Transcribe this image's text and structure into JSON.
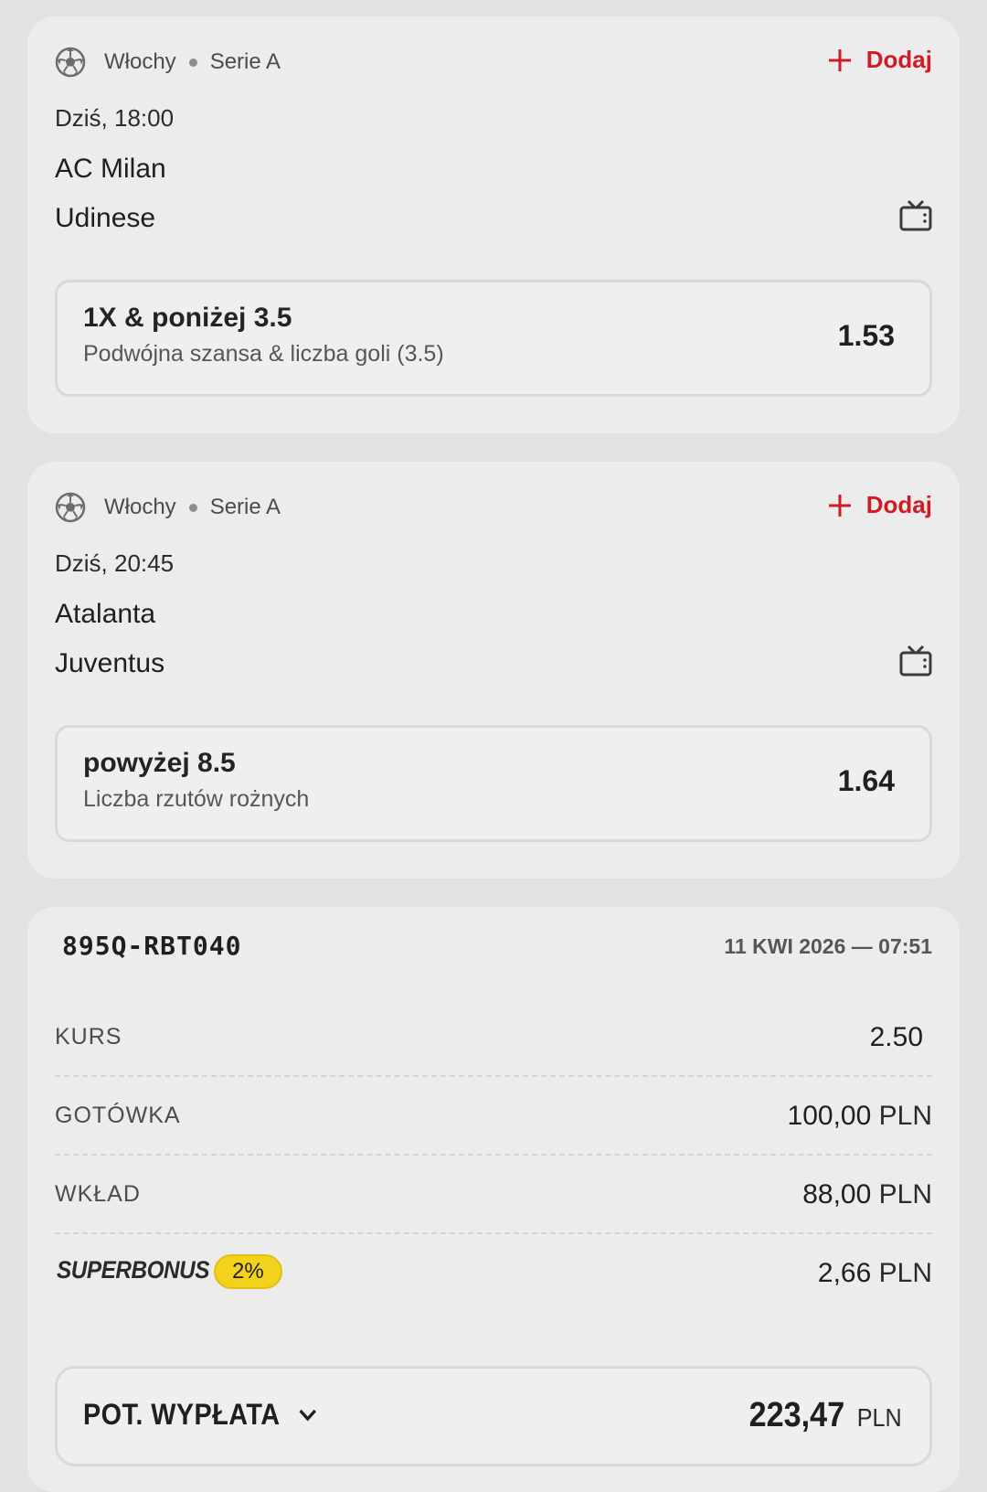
{
  "matches": [
    {
      "country": "Włochy",
      "league": "Serie A",
      "add_label": "Dodaj",
      "time": "Dziś, 18:00",
      "home": "AC Milan",
      "away": "Udinese",
      "bet": {
        "selection": "1X & poniżej 3.5",
        "market": "Podwójna szansa & liczba goli (3.5)",
        "odds": "1.53"
      }
    },
    {
      "country": "Włochy",
      "league": "Serie A",
      "add_label": "Dodaj",
      "time": "Dziś, 20:45",
      "home": "Atalanta",
      "away": "Juventus",
      "bet": {
        "selection": "powyżej 8.5",
        "market": "Liczba rzutów rożnych",
        "odds": "1.64"
      }
    }
  ],
  "summary": {
    "ticket_id": "895Q-RBT040",
    "date": "11 KWI 2026 — 07:51",
    "kurs_label": "KURS",
    "kurs_value": "2.50",
    "gotowka_label": "GOTÓWKA",
    "gotowka_amount": "100,00",
    "wklad_label": "WKŁAD",
    "wklad_amount": "88,00",
    "superbonus_label": "SUPERBONUS",
    "superbonus_pct": "2%",
    "superbonus_amount": "2,66",
    "currency": "PLN",
    "payout_label": "POT. WYPŁATA",
    "payout_amount": "223,47"
  },
  "colors": {
    "accent": "#d11a24",
    "badge": "#f2d21b",
    "background": "#e1e2e4",
    "card": "#ececec"
  },
  "icons": [
    "soccer-ball-icon",
    "plus-icon",
    "tv-icon",
    "chevron-down-icon"
  ]
}
